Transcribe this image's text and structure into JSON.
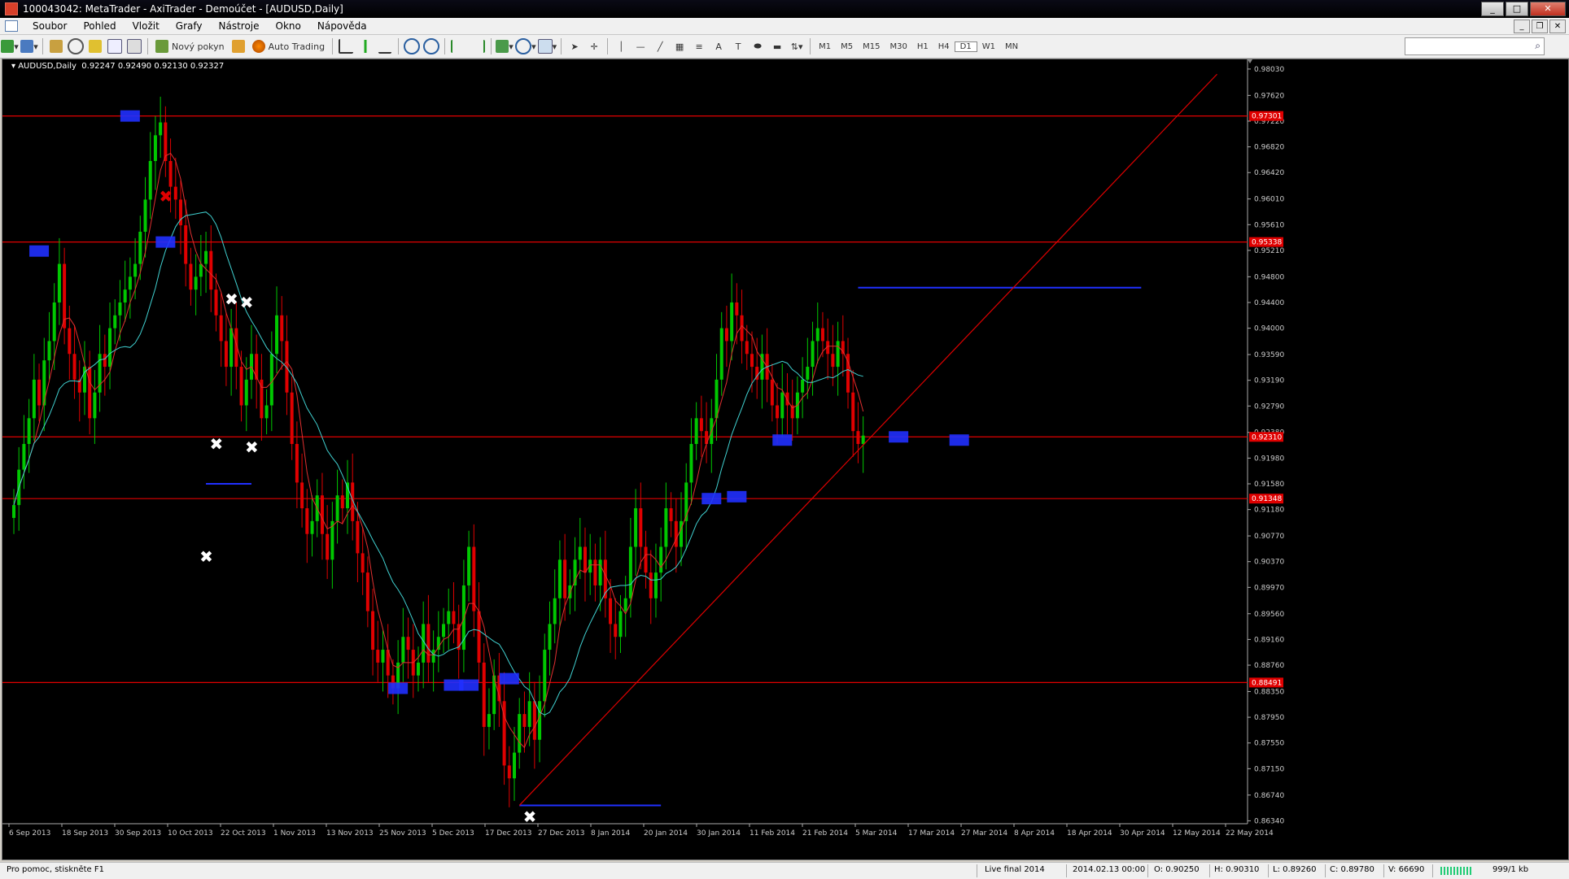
{
  "window": {
    "title": "100043042: MetaTrader - AxiTrader - Demoúčet - [AUDUSD,Daily]",
    "min": "_",
    "max": "□",
    "close": "✕"
  },
  "menu": {
    "items": [
      "Soubor",
      "Pohled",
      "Vložit",
      "Grafy",
      "Nástroje",
      "Okno",
      "Nápověda"
    ]
  },
  "toolbar": {
    "new_order": "Nový pokyn",
    "auto_trading": "Auto Trading",
    "timeframes": [
      "M1",
      "M5",
      "M15",
      "M30",
      "H1",
      "H4",
      "D1",
      "W1",
      "MN"
    ],
    "active_timeframe": "D1",
    "search_placeholder": ""
  },
  "chart": {
    "symbol_label": "AUDUSD,Daily",
    "ohlc_text": "0.92247 0.92490 0.92130 0.92327",
    "bg": "#000000",
    "bull_color": "#00c800",
    "bear_color": "#e00000",
    "grid": false,
    "y_range": [
      0.8632,
      0.9813
    ],
    "y_ticks": [
      "0.98030",
      "0.97620",
      "0.97220",
      "0.96820",
      "0.96420",
      "0.96010",
      "0.95610",
      "0.95210",
      "0.94800",
      "0.94400",
      "0.94000",
      "0.93590",
      "0.93190",
      "0.92790",
      "0.92380",
      "0.91980",
      "0.91580",
      "0.91180",
      "0.90770",
      "0.90370",
      "0.89970",
      "0.89560",
      "0.89160",
      "0.88760",
      "0.88350",
      "0.87950",
      "0.87550",
      "0.87150",
      "0.86740",
      "0.86340"
    ],
    "x_labels": [
      "6 Sep 2013",
      "18 Sep 2013",
      "30 Sep 2013",
      "10 Oct 2013",
      "22 Oct 2013",
      "1 Nov 2013",
      "13 Nov 2013",
      "25 Nov 2013",
      "5 Dec 2013",
      "17 Dec 2013",
      "27 Dec 2013",
      "8 Jan 2014",
      "20 Jan 2014",
      "30 Jan 2014",
      "11 Feb 2014",
      "21 Feb 2014",
      "5 Mar 2014",
      "17 Mar 2014",
      "27 Mar 2014",
      "8 Apr 2014",
      "18 Apr 2014",
      "30 Apr 2014",
      "12 May 2014",
      "22 May 2014"
    ],
    "price_tags": [
      {
        "price": 0.973,
        "label": "0.97301",
        "color": "#e00000"
      },
      {
        "price": 0.9534,
        "label": "0.95338",
        "color": "#e00000"
      },
      {
        "price": 0.9231,
        "label": "0.92310",
        "color": "#e00000"
      },
      {
        "price": 0.9135,
        "label": "0.91348",
        "color": "#e00000"
      },
      {
        "price": 0.8849,
        "label": "0.88491",
        "color": "#e00000"
      }
    ],
    "levels": [
      0.973,
      0.9534,
      0.9231,
      0.9135,
      0.8849
    ],
    "closes": [
      0.9125,
      0.918,
      0.922,
      0.926,
      0.932,
      0.928,
      0.935,
      0.938,
      0.944,
      0.95,
      0.94,
      0.936,
      0.932,
      0.93,
      0.934,
      0.926,
      0.93,
      0.936,
      0.934,
      0.94,
      0.942,
      0.944,
      0.946,
      0.948,
      0.95,
      0.955,
      0.96,
      0.966,
      0.97,
      0.972,
      0.966,
      0.962,
      0.96,
      0.956,
      0.95,
      0.946,
      0.948,
      0.95,
      0.952,
      0.946,
      0.942,
      0.938,
      0.934,
      0.94,
      0.934,
      0.928,
      0.932,
      0.936,
      0.932,
      0.926,
      0.928,
      0.936,
      0.942,
      0.938,
      0.93,
      0.922,
      0.916,
      0.912,
      0.908,
      0.91,
      0.914,
      0.908,
      0.904,
      0.91,
      0.914,
      0.912,
      0.916,
      0.91,
      0.905,
      0.902,
      0.896,
      0.89,
      0.888,
      0.89,
      0.886,
      0.884,
      0.888,
      0.892,
      0.89,
      0.886,
      0.888,
      0.894,
      0.888,
      0.89,
      0.892,
      0.894,
      0.896,
      0.894,
      0.89,
      0.9,
      0.906,
      0.896,
      0.888,
      0.878,
      0.88,
      0.886,
      0.882,
      0.872,
      0.87,
      0.874,
      0.88,
      0.878,
      0.882,
      0.876,
      0.882,
      0.89,
      0.894,
      0.898,
      0.904,
      0.898,
      0.9,
      0.904,
      0.906,
      0.902,
      0.904,
      0.9,
      0.904,
      0.898,
      0.894,
      0.892,
      0.896,
      0.898,
      0.906,
      0.912,
      0.906,
      0.902,
      0.898,
      0.902,
      0.906,
      0.912,
      0.91,
      0.906,
      0.91,
      0.916,
      0.922,
      0.926,
      0.924,
      0.922,
      0.926,
      0.932,
      0.94,
      0.938,
      0.944,
      0.942,
      0.938,
      0.936,
      0.934,
      0.932,
      0.936,
      0.932,
      0.928,
      0.926,
      0.93,
      0.928,
      0.926,
      0.93,
      0.932,
      0.934,
      0.938,
      0.94,
      0.938,
      0.936,
      0.934,
      0.938,
      0.936,
      0.93,
      0.924,
      0.922,
      0.9233
    ],
    "annotations_blue_boxes": [
      {
        "i": 5,
        "price": 0.952
      },
      {
        "i": 23,
        "price": 0.973
      },
      {
        "i": 30,
        "price": 0.9534
      },
      {
        "i": 76,
        "price": 0.884
      },
      {
        "i": 87,
        "price": 0.8845
      },
      {
        "i": 90,
        "price": 0.8845
      },
      {
        "i": 98,
        "price": 0.8855
      },
      {
        "i": 138,
        "price": 0.9135
      },
      {
        "i": 143,
        "price": 0.9138
      },
      {
        "i": 152,
        "price": 0.9226
      },
      {
        "i": 175,
        "price": 0.9231
      },
      {
        "i": 187,
        "price": 0.9226
      }
    ],
    "white_x": [
      {
        "i": 43,
        "price": 0.9445
      },
      {
        "i": 46,
        "price": 0.944
      },
      {
        "i": 40,
        "price": 0.922
      },
      {
        "i": 47,
        "price": 0.9215
      },
      {
        "i": 38,
        "price": 0.9045
      },
      {
        "i": 102,
        "price": 0.864
      }
    ],
    "red_x": [
      {
        "i": 30,
        "price": 0.9605
      }
    ],
    "blue_hlines": [
      {
        "i1": 38,
        "i2": 47,
        "price": 0.9158
      },
      {
        "i1": 100,
        "i2": 128,
        "price": 0.8658
      },
      {
        "i1": 167,
        "i2": 223,
        "price": 0.9463
      }
    ],
    "trendline": {
      "i1": 100,
      "p1": 0.8658,
      "i2": 238,
      "p2": 0.9795
    },
    "candle_count": 190
  },
  "status": {
    "help": "Pro pomoc, stiskněte F1",
    "profile": "Live final 2014",
    "datetime": "2014.02.13 00:00",
    "open": "O: 0.90250",
    "high": "H: 0.90310",
    "low": "L: 0.89260",
    "close": "C: 0.89780",
    "volume": "V: 66690",
    "traffic": "999/1 kb"
  }
}
